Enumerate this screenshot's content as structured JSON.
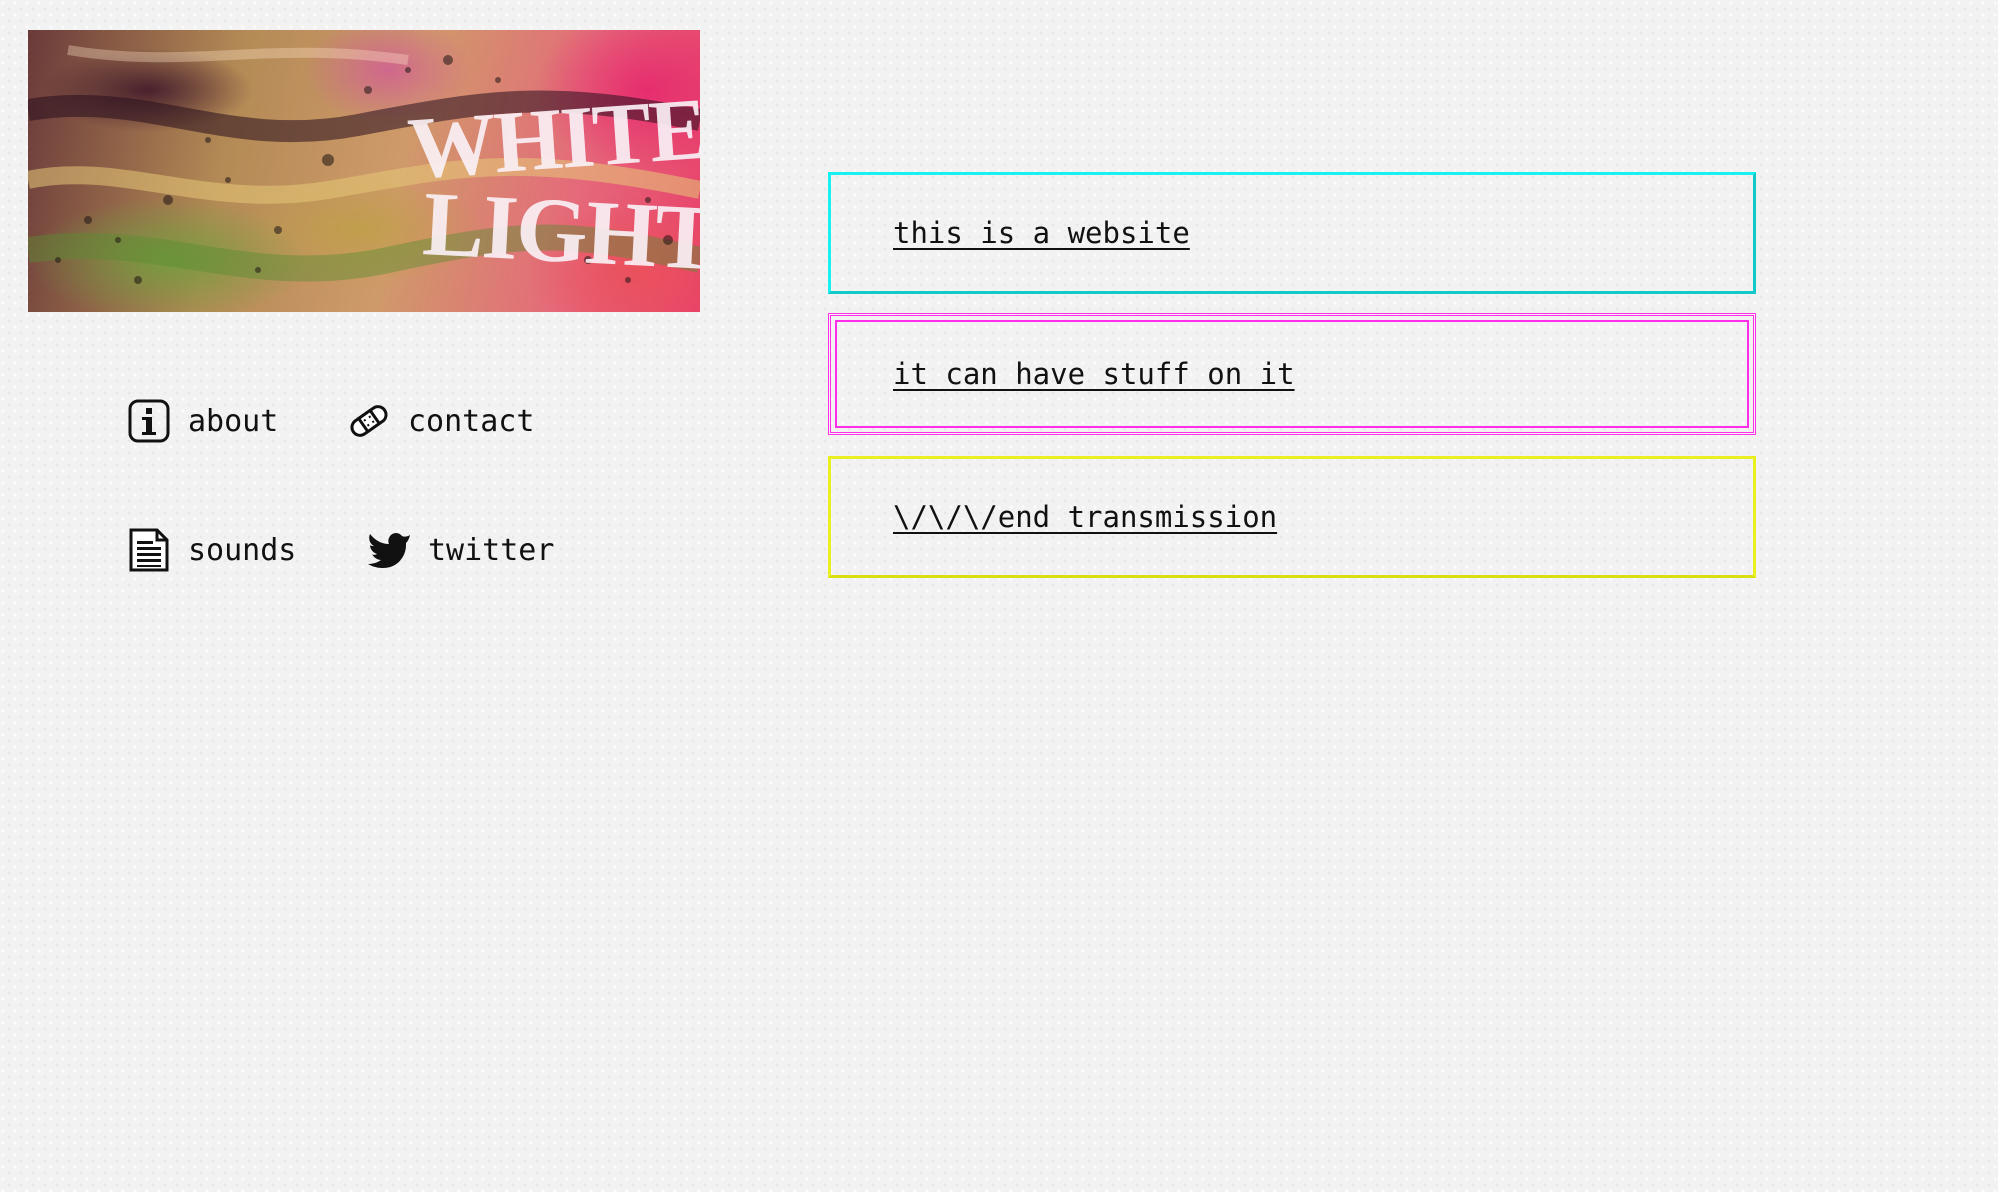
{
  "banner": {
    "logo_text_line1": "WHITE",
    "logo_text_line2": "LIGHT"
  },
  "nav": {
    "items": [
      {
        "label": "about",
        "icon": "info-icon"
      },
      {
        "label": "contact",
        "icon": "bandage-icon"
      },
      {
        "label": "sounds",
        "icon": "document-icon"
      },
      {
        "label": "twitter",
        "icon": "twitter-bird-icon"
      }
    ]
  },
  "content": {
    "boxes": [
      {
        "text": "this is a website",
        "border_color": "#19f0f0"
      },
      {
        "text": "it can have stuff on it",
        "border_color": "#ff2ee8"
      },
      {
        "text": "\\/\\/\\/end transmission",
        "border_color": "#eaf020"
      }
    ]
  }
}
